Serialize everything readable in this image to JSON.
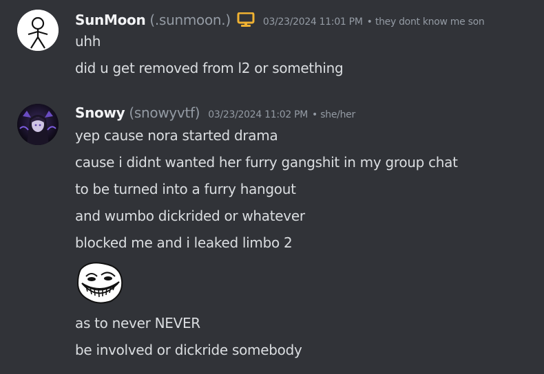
{
  "messages": [
    {
      "username": "SunMoon",
      "handle": "(.sunmoon.)",
      "badge_icon": "computer-monitor-icon",
      "badge_color": "#f0b232",
      "timestamp": "03/23/2024 11:01 PM",
      "separator": "•",
      "pronouns": "they dont know me son",
      "lines": [
        "uhh",
        "did u get removed from l2 or something"
      ]
    },
    {
      "username": "Snowy",
      "handle": "(snowyvtf)",
      "timestamp": "03/23/2024 11:02 PM",
      "separator": "•",
      "pronouns": "she/her",
      "lines": [
        "yep cause nora started drama",
        "cause i didnt wanted her furry gangshit in my group chat",
        "to be turned into a furry hangout",
        "and wumbo dickrided or whatever",
        "blocked me and i leaked limbo 2"
      ],
      "emoji": "trollface-emoji",
      "after_emoji_lines": [
        "as to never NEVER",
        "be involved or dickride somebody"
      ]
    }
  ],
  "colors": {
    "background": "#313338",
    "username": "#f2f3f5",
    "muted": "#949ba4",
    "text": "#dbdee1"
  }
}
